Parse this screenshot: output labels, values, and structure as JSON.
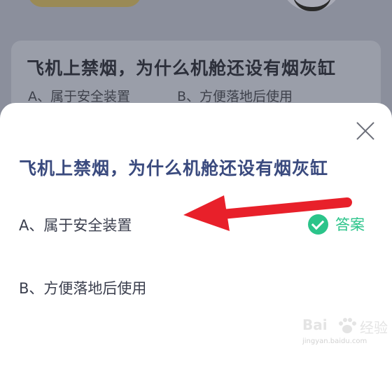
{
  "background": {
    "question": "飞机上禁烟，为什么机舱还设有烟灰缸",
    "option_a": "A、属于安全装置",
    "option_b": "B、方便落地后使用"
  },
  "sheet": {
    "question": "飞机上禁烟，为什么机舱还设有烟灰缸",
    "options": [
      {
        "label": "A、属于安全装置",
        "is_answer": true
      },
      {
        "label": "B、方便落地后使用",
        "is_answer": false
      }
    ],
    "answer_label": "答案"
  },
  "watermark": {
    "brand_left": "Bai",
    "brand_right": "经验",
    "url": "jingyan.baidu.com"
  },
  "colors": {
    "accent_green": "#2bc48a",
    "title_blue": "#3a4a7e",
    "arrow_red": "#e8202a",
    "overlay": "#8b8f9c"
  },
  "icons": [
    "close-icon",
    "check-circle-icon",
    "baidu-paw-icon"
  ]
}
